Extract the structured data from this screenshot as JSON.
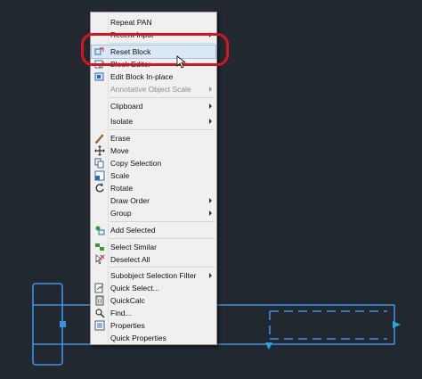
{
  "context_menu": {
    "items": [
      {
        "label": "Repeat PAN",
        "icon": "",
        "submenu": false,
        "disabled": false
      },
      {
        "label": "Recent Input",
        "icon": "",
        "submenu": true,
        "disabled": false
      },
      {
        "label": "Reset Block",
        "icon": "reset-block-icon",
        "submenu": false,
        "disabled": false,
        "hover": true
      },
      {
        "label": "Block Editor",
        "icon": "block-editor-icon",
        "submenu": false,
        "disabled": false
      },
      {
        "label": "Edit Block In-place",
        "icon": "edit-block-in-place-icon",
        "submenu": false,
        "disabled": false
      },
      {
        "label": "Annotative Object Scale",
        "icon": "",
        "submenu": true,
        "disabled": true
      },
      {
        "label": "Clipboard",
        "icon": "",
        "submenu": true,
        "disabled": false
      },
      {
        "label": "Isolate",
        "icon": "",
        "submenu": true,
        "disabled": false
      },
      {
        "label": "Erase",
        "icon": "erase-icon",
        "submenu": false,
        "disabled": false
      },
      {
        "label": "Move",
        "icon": "move-icon",
        "submenu": false,
        "disabled": false
      },
      {
        "label": "Copy Selection",
        "icon": "copy-icon",
        "submenu": false,
        "disabled": false
      },
      {
        "label": "Scale",
        "icon": "scale-icon",
        "submenu": false,
        "disabled": false
      },
      {
        "label": "Rotate",
        "icon": "rotate-icon",
        "submenu": false,
        "disabled": false
      },
      {
        "label": "Draw Order",
        "icon": "",
        "submenu": true,
        "disabled": false
      },
      {
        "label": "Group",
        "icon": "",
        "submenu": true,
        "disabled": false
      },
      {
        "label": "Add Selected",
        "icon": "add-selected-icon",
        "submenu": false,
        "disabled": false
      },
      {
        "label": "Select Similar",
        "icon": "select-similar-icon",
        "submenu": false,
        "disabled": false
      },
      {
        "label": "Deselect All",
        "icon": "deselect-all-icon",
        "submenu": false,
        "disabled": false
      },
      {
        "label": "Subobject Selection Filter",
        "icon": "",
        "submenu": true,
        "disabled": false
      },
      {
        "label": "Quick Select...",
        "icon": "quick-select-icon",
        "submenu": false,
        "disabled": false
      },
      {
        "label": "QuickCalc",
        "icon": "calculator-icon",
        "submenu": false,
        "disabled": false
      },
      {
        "label": "Find...",
        "icon": "find-icon",
        "submenu": false,
        "disabled": false
      },
      {
        "label": "Properties",
        "icon": "properties-icon",
        "submenu": false,
        "disabled": false
      },
      {
        "label": "Quick Properties",
        "icon": "",
        "submenu": false,
        "disabled": false
      }
    ]
  },
  "colors": {
    "background": "#212830",
    "drawing_lines": "#3f8fe6",
    "highlight_ring": "#d8141e",
    "menu_hover": "#dbe9f7"
  }
}
